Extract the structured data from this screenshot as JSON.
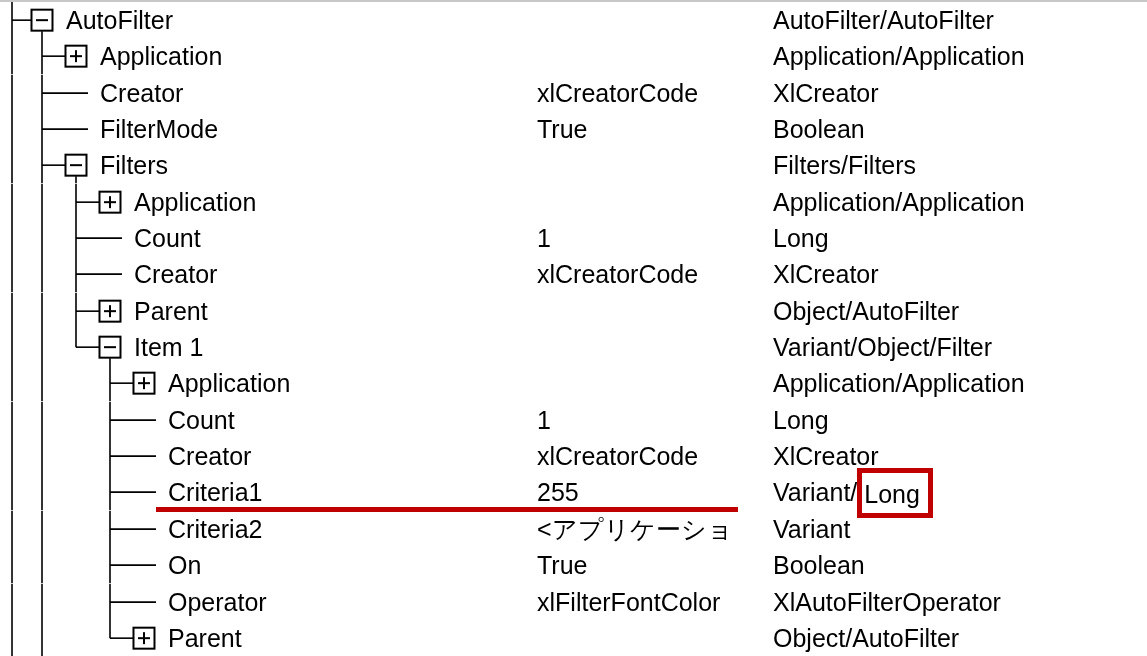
{
  "tree": {
    "more_below": true,
    "items": [
      {
        "name": "AutoFilter",
        "kind": "object",
        "expanded": true,
        "more_children_below": true,
        "type": "AutoFilter/AutoFilter",
        "underlined": false,
        "children": [
          {
            "name": "Application",
            "kind": "object",
            "expanded": false,
            "type": "Application/Application",
            "underlined": false
          },
          {
            "name": "Creator",
            "kind": "value",
            "value": "xlCreatorCode",
            "type": "XlCreator",
            "underlined": false
          },
          {
            "name": "FilterMode",
            "kind": "value",
            "value": "True",
            "type": "Boolean",
            "underlined": false
          },
          {
            "name": "Filters",
            "kind": "object",
            "expanded": true,
            "type": "Filters/Filters",
            "underlined": false,
            "children": [
              {
                "name": "Application",
                "kind": "object",
                "expanded": false,
                "type": "Application/Application",
                "underlined": false
              },
              {
                "name": "Count",
                "kind": "value",
                "value": "1",
                "type": "Long",
                "underlined": false
              },
              {
                "name": "Creator",
                "kind": "value",
                "value": "xlCreatorCode",
                "type": "XlCreator",
                "underlined": false
              },
              {
                "name": "Parent",
                "kind": "object",
                "expanded": false,
                "type": "Object/AutoFilter",
                "underlined": false
              },
              {
                "name": "Item 1",
                "kind": "object",
                "expanded": true,
                "type": "Variant/Object/Filter",
                "underlined": false,
                "children": [
                  {
                    "name": "Application",
                    "kind": "object",
                    "expanded": false,
                    "type": "Application/Application",
                    "underlined": false
                  },
                  {
                    "name": "Count",
                    "kind": "value",
                    "value": "1",
                    "type": "Long",
                    "underlined": false
                  },
                  {
                    "name": "Creator",
                    "kind": "value",
                    "value": "xlCreatorCode",
                    "type": "XlCreator",
                    "underlined": false
                  },
                  {
                    "name": "Criteria1",
                    "kind": "value",
                    "value": "255",
                    "type": "Variant/",
                    "type_boxed": "Long",
                    "underlined": true
                  },
                  {
                    "name": "Criteria2",
                    "kind": "value",
                    "value": "<アプリケーショ",
                    "type": "Variant",
                    "underlined": false
                  },
                  {
                    "name": "On",
                    "kind": "value",
                    "value": "True",
                    "type": "Boolean",
                    "underlined": false
                  },
                  {
                    "name": "Operator",
                    "kind": "value",
                    "value": "xlFilterFontColor",
                    "type": "XlAutoFilterOperator",
                    "underlined": false
                  },
                  {
                    "name": "Parent",
                    "kind": "object",
                    "expanded": false,
                    "type": "Object/AutoFilter",
                    "underlined": false
                  }
                ]
              }
            ]
          }
        ]
      }
    ]
  }
}
